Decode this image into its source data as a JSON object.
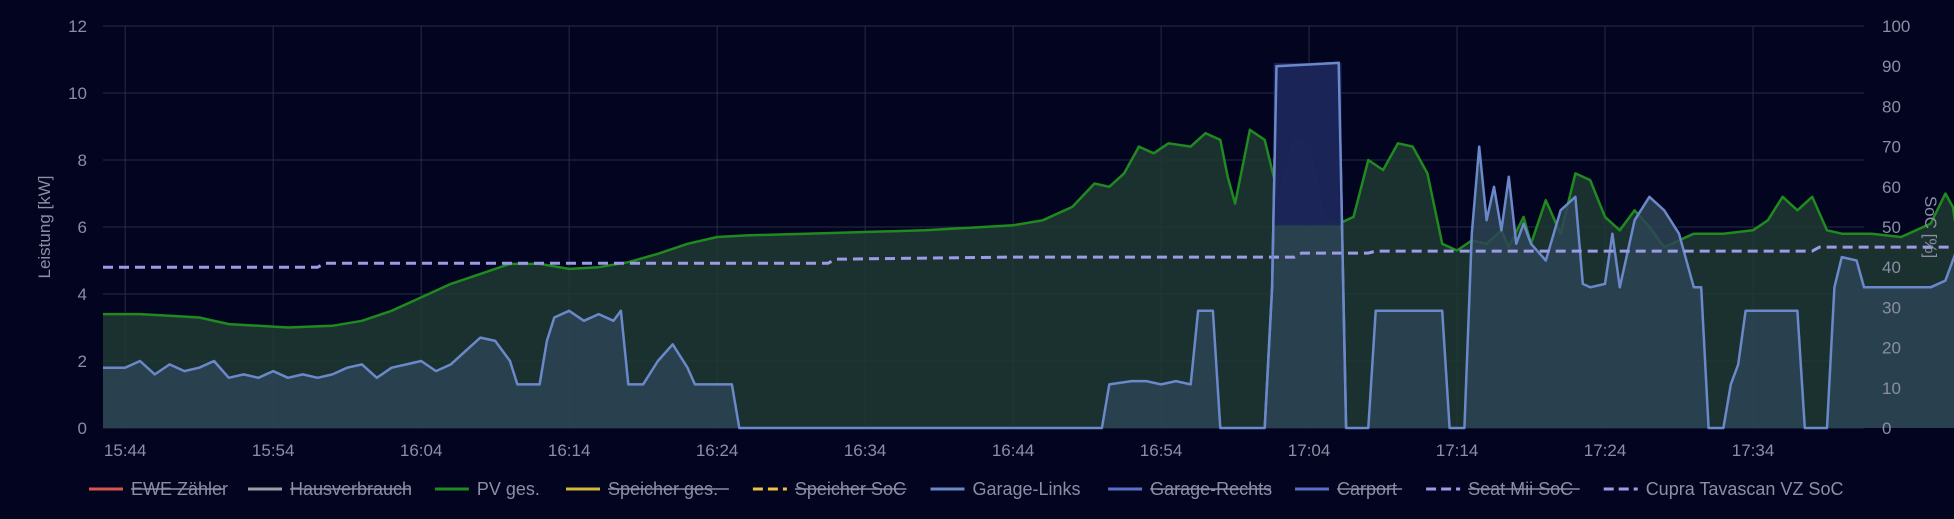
{
  "chart_data": {
    "type": "line",
    "y_axis_left": {
      "label": "Leistung [kW]",
      "range": [
        0,
        12
      ],
      "ticks": [
        "0",
        "2",
        "4",
        "6",
        "8",
        "10",
        "12"
      ]
    },
    "y_axis_right": {
      "label": "SoC [%]",
      "range": [
        0,
        100
      ],
      "ticks": [
        "0",
        "10",
        "20",
        "30",
        "40",
        "50",
        "60",
        "70",
        "80",
        "90",
        "100"
      ]
    },
    "x_axis": {
      "range_minutes": [
        942.5,
        1061.5
      ],
      "ticks": [
        {
          "label": "15:44",
          "minute": 944
        },
        {
          "label": "15:54",
          "minute": 954
        },
        {
          "label": "16:04",
          "minute": 964
        },
        {
          "label": "16:14",
          "minute": 974
        },
        {
          "label": "16:24",
          "minute": 984
        },
        {
          "label": "16:34",
          "minute": 994
        },
        {
          "label": "16:44",
          "minute": 1004
        },
        {
          "label": "16:54",
          "minute": 1014
        },
        {
          "label": "17:04",
          "minute": 1024
        },
        {
          "label": "17:14",
          "minute": 1034
        },
        {
          "label": "17:24",
          "minute": 1044
        },
        {
          "label": "17:34",
          "minute": 1054
        }
      ]
    },
    "grid": true,
    "legend_position": "bottom",
    "legend": [
      {
        "name": "EWE Zähler",
        "color": "#d9534f",
        "dash": false,
        "hidden": true
      },
      {
        "name": "Hausverbrauch",
        "color": "#9aa0a6",
        "dash": false,
        "hidden": true
      },
      {
        "name": "PV ges.",
        "color": "#1f8a1f",
        "dash": false,
        "hidden": false
      },
      {
        "name": "Speicher ges.",
        "color": "#d4b83a",
        "dash": false,
        "hidden": true
      },
      {
        "name": "Speicher SoC",
        "color": "#f0c040",
        "dash": true,
        "hidden": true
      },
      {
        "name": "Garage-Links",
        "color": "#6b88c9",
        "dash": false,
        "hidden": false
      },
      {
        "name": "Garage-Rechts",
        "color": "#5a70c8",
        "dash": false,
        "hidden": true
      },
      {
        "name": "Carport",
        "color": "#5a70c8",
        "dash": false,
        "hidden": true
      },
      {
        "name": "Seat Mii SoC",
        "color": "#9d9be8",
        "dash": true,
        "hidden": true
      },
      {
        "name": "Cupra Tavascan VZ SoC",
        "color": "#9d9be8",
        "dash": true,
        "hidden": false
      }
    ],
    "series": [
      {
        "name": "PV ges.",
        "axis": "left",
        "color": "#1f8a1f",
        "fill": "#1e3a32",
        "points": [
          [
            942.5,
            3.4
          ],
          [
            945,
            3.4
          ],
          [
            947,
            3.35
          ],
          [
            949,
            3.3
          ],
          [
            951,
            3.1
          ],
          [
            953,
            3.05
          ],
          [
            955,
            3.0
          ],
          [
            958,
            3.05
          ],
          [
            960,
            3.2
          ],
          [
            962,
            3.5
          ],
          [
            964,
            3.9
          ],
          [
            966,
            4.3
          ],
          [
            968,
            4.6
          ],
          [
            970,
            4.9
          ],
          [
            972,
            4.9
          ],
          [
            974,
            4.75
          ],
          [
            976,
            4.8
          ],
          [
            978,
            4.95
          ],
          [
            980,
            5.2
          ],
          [
            982,
            5.5
          ],
          [
            984,
            5.7
          ],
          [
            986,
            5.75
          ],
          [
            990,
            5.8
          ],
          [
            994,
            5.85
          ],
          [
            998,
            5.9
          ],
          [
            1002,
            6.0
          ],
          [
            1004,
            6.05
          ],
          [
            1006,
            6.2
          ],
          [
            1008,
            6.6
          ],
          [
            1009.5,
            7.3
          ],
          [
            1010.5,
            7.2
          ],
          [
            1011.5,
            7.6
          ],
          [
            1012.5,
            8.4
          ],
          [
            1013.5,
            8.2
          ],
          [
            1014.5,
            8.5
          ],
          [
            1016,
            8.4
          ],
          [
            1017,
            8.8
          ],
          [
            1018,
            8.6
          ],
          [
            1018.5,
            7.5
          ],
          [
            1019,
            6.7
          ],
          [
            1020,
            8.9
          ],
          [
            1021,
            8.6
          ],
          [
            1022,
            6.8
          ],
          [
            1023,
            8.6
          ],
          [
            1024,
            8.4
          ],
          [
            1025,
            6.2
          ],
          [
            1026,
            6.1
          ],
          [
            1027,
            6.3
          ],
          [
            1028,
            8.0
          ],
          [
            1029,
            7.7
          ],
          [
            1030,
            8.5
          ],
          [
            1031,
            8.4
          ],
          [
            1032,
            7.6
          ],
          [
            1033,
            5.5
          ],
          [
            1034,
            5.3
          ],
          [
            1035,
            5.6
          ],
          [
            1036,
            5.5
          ],
          [
            1037,
            5.9
          ],
          [
            1037.5,
            5.4
          ],
          [
            1038.5,
            6.3
          ],
          [
            1039,
            5.5
          ],
          [
            1040,
            6.8
          ],
          [
            1041,
            5.8
          ],
          [
            1042,
            7.6
          ],
          [
            1043,
            7.4
          ],
          [
            1044,
            6.3
          ],
          [
            1045,
            5.9
          ],
          [
            1046,
            6.5
          ],
          [
            1047,
            6.0
          ],
          [
            1048,
            5.4
          ],
          [
            1050,
            5.8
          ],
          [
            1052,
            5.8
          ],
          [
            1054,
            5.9
          ],
          [
            1055,
            6.2
          ],
          [
            1056,
            6.9
          ],
          [
            1057,
            6.5
          ],
          [
            1058,
            6.9
          ],
          [
            1059,
            5.9
          ],
          [
            1060,
            5.8
          ],
          [
            1062,
            5.8
          ],
          [
            1064,
            5.7
          ],
          [
            1066,
            6.1
          ],
          [
            1067,
            7.0
          ],
          [
            1067.5,
            6.6
          ],
          [
            1068,
            5.2
          ],
          [
            1068.5,
            5.9
          ],
          [
            1069,
            5.4
          ],
          [
            1069.5,
            5.7
          ]
        ]
      },
      {
        "name": "Garage-Links",
        "axis": "left",
        "color": "#6b88c9",
        "fill": "#2d4455",
        "points": [
          [
            942.5,
            1.8
          ],
          [
            944,
            1.8
          ],
          [
            945,
            2.0
          ],
          [
            946,
            1.6
          ],
          [
            947,
            1.9
          ],
          [
            948,
            1.7
          ],
          [
            949,
            1.8
          ],
          [
            950,
            2.0
          ],
          [
            951,
            1.5
          ],
          [
            952,
            1.6
          ],
          [
            953,
            1.5
          ],
          [
            954,
            1.7
          ],
          [
            955,
            1.5
          ],
          [
            956,
            1.6
          ],
          [
            957,
            1.5
          ],
          [
            958,
            1.6
          ],
          [
            959,
            1.8
          ],
          [
            960,
            1.9
          ],
          [
            961,
            1.5
          ],
          [
            962,
            1.8
          ],
          [
            963,
            1.9
          ],
          [
            964,
            2.0
          ],
          [
            965,
            1.7
          ],
          [
            966,
            1.9
          ],
          [
            967,
            2.3
          ],
          [
            968,
            2.7
          ],
          [
            969,
            2.6
          ],
          [
            970,
            2.0
          ],
          [
            970.5,
            1.3
          ],
          [
            972,
            1.3
          ],
          [
            972.5,
            2.6
          ],
          [
            973,
            3.3
          ],
          [
            974,
            3.5
          ],
          [
            975,
            3.2
          ],
          [
            976,
            3.4
          ],
          [
            977,
            3.2
          ],
          [
            977.5,
            3.5
          ],
          [
            978,
            1.3
          ],
          [
            979,
            1.3
          ],
          [
            980,
            2.0
          ],
          [
            981,
            2.5
          ],
          [
            982,
            1.8
          ],
          [
            982.5,
            1.3
          ],
          [
            985,
            1.3
          ],
          [
            985.5,
            0
          ],
          [
            1010,
            0
          ],
          [
            1010.5,
            1.3
          ],
          [
            1012,
            1.4
          ],
          [
            1013,
            1.4
          ],
          [
            1014,
            1.3
          ],
          [
            1015,
            1.4
          ],
          [
            1016,
            1.3
          ],
          [
            1016.5,
            3.5
          ],
          [
            1017.5,
            3.5
          ],
          [
            1018,
            0
          ],
          [
            1021,
            0
          ],
          [
            1021.5,
            4.2
          ],
          [
            1021.8,
            10.8
          ],
          [
            1026,
            10.9
          ],
          [
            1026.5,
            0
          ],
          [
            1028,
            0
          ],
          [
            1028.5,
            3.5
          ],
          [
            1033,
            3.5
          ],
          [
            1033.5,
            0
          ],
          [
            1034.5,
            0
          ],
          [
            1035,
            5.8
          ],
          [
            1035.5,
            8.4
          ],
          [
            1036,
            6.2
          ],
          [
            1036.5,
            7.2
          ],
          [
            1037,
            5.9
          ],
          [
            1037.5,
            7.5
          ],
          [
            1038,
            5.5
          ],
          [
            1038.5,
            6.1
          ],
          [
            1039,
            5.5
          ],
          [
            1040,
            5.0
          ],
          [
            1041,
            6.5
          ],
          [
            1042,
            6.9
          ],
          [
            1042.5,
            4.3
          ],
          [
            1043,
            4.2
          ],
          [
            1044,
            4.3
          ],
          [
            1044.5,
            5.8
          ],
          [
            1045,
            4.2
          ],
          [
            1046,
            6.2
          ],
          [
            1047,
            6.9
          ],
          [
            1048,
            6.5
          ],
          [
            1049,
            5.8
          ],
          [
            1050,
            4.2
          ],
          [
            1050.5,
            4.2
          ],
          [
            1051,
            0
          ],
          [
            1052,
            0
          ],
          [
            1052.5,
            1.3
          ],
          [
            1053,
            1.9
          ],
          [
            1053.5,
            3.5
          ],
          [
            1057,
            3.5
          ],
          [
            1057.5,
            0
          ],
          [
            1059,
            0
          ],
          [
            1059.5,
            4.2
          ],
          [
            1060,
            5.1
          ],
          [
            1061,
            5.0
          ],
          [
            1061.5,
            4.2
          ],
          [
            1064,
            4.2
          ],
          [
            1066,
            4.2
          ],
          [
            1067,
            4.4
          ],
          [
            1068,
            5.6
          ],
          [
            1069,
            5.2
          ],
          [
            1069.5,
            4.2
          ]
        ]
      },
      {
        "name": "Cupra Tavascan VZ SoC",
        "axis": "right",
        "color": "#9d9be8",
        "dash": true,
        "points": [
          [
            942.5,
            40
          ],
          [
            957,
            40
          ],
          [
            957.5,
            41
          ],
          [
            991.5,
            41
          ],
          [
            992,
            42
          ],
          [
            1004,
            42.5
          ],
          [
            1023,
            42.5
          ],
          [
            1023.5,
            43.5
          ],
          [
            1028,
            43.5
          ],
          [
            1028.5,
            44
          ],
          [
            1058,
            44
          ],
          [
            1058.5,
            45
          ],
          [
            1069.5,
            45
          ]
        ]
      }
    ]
  }
}
